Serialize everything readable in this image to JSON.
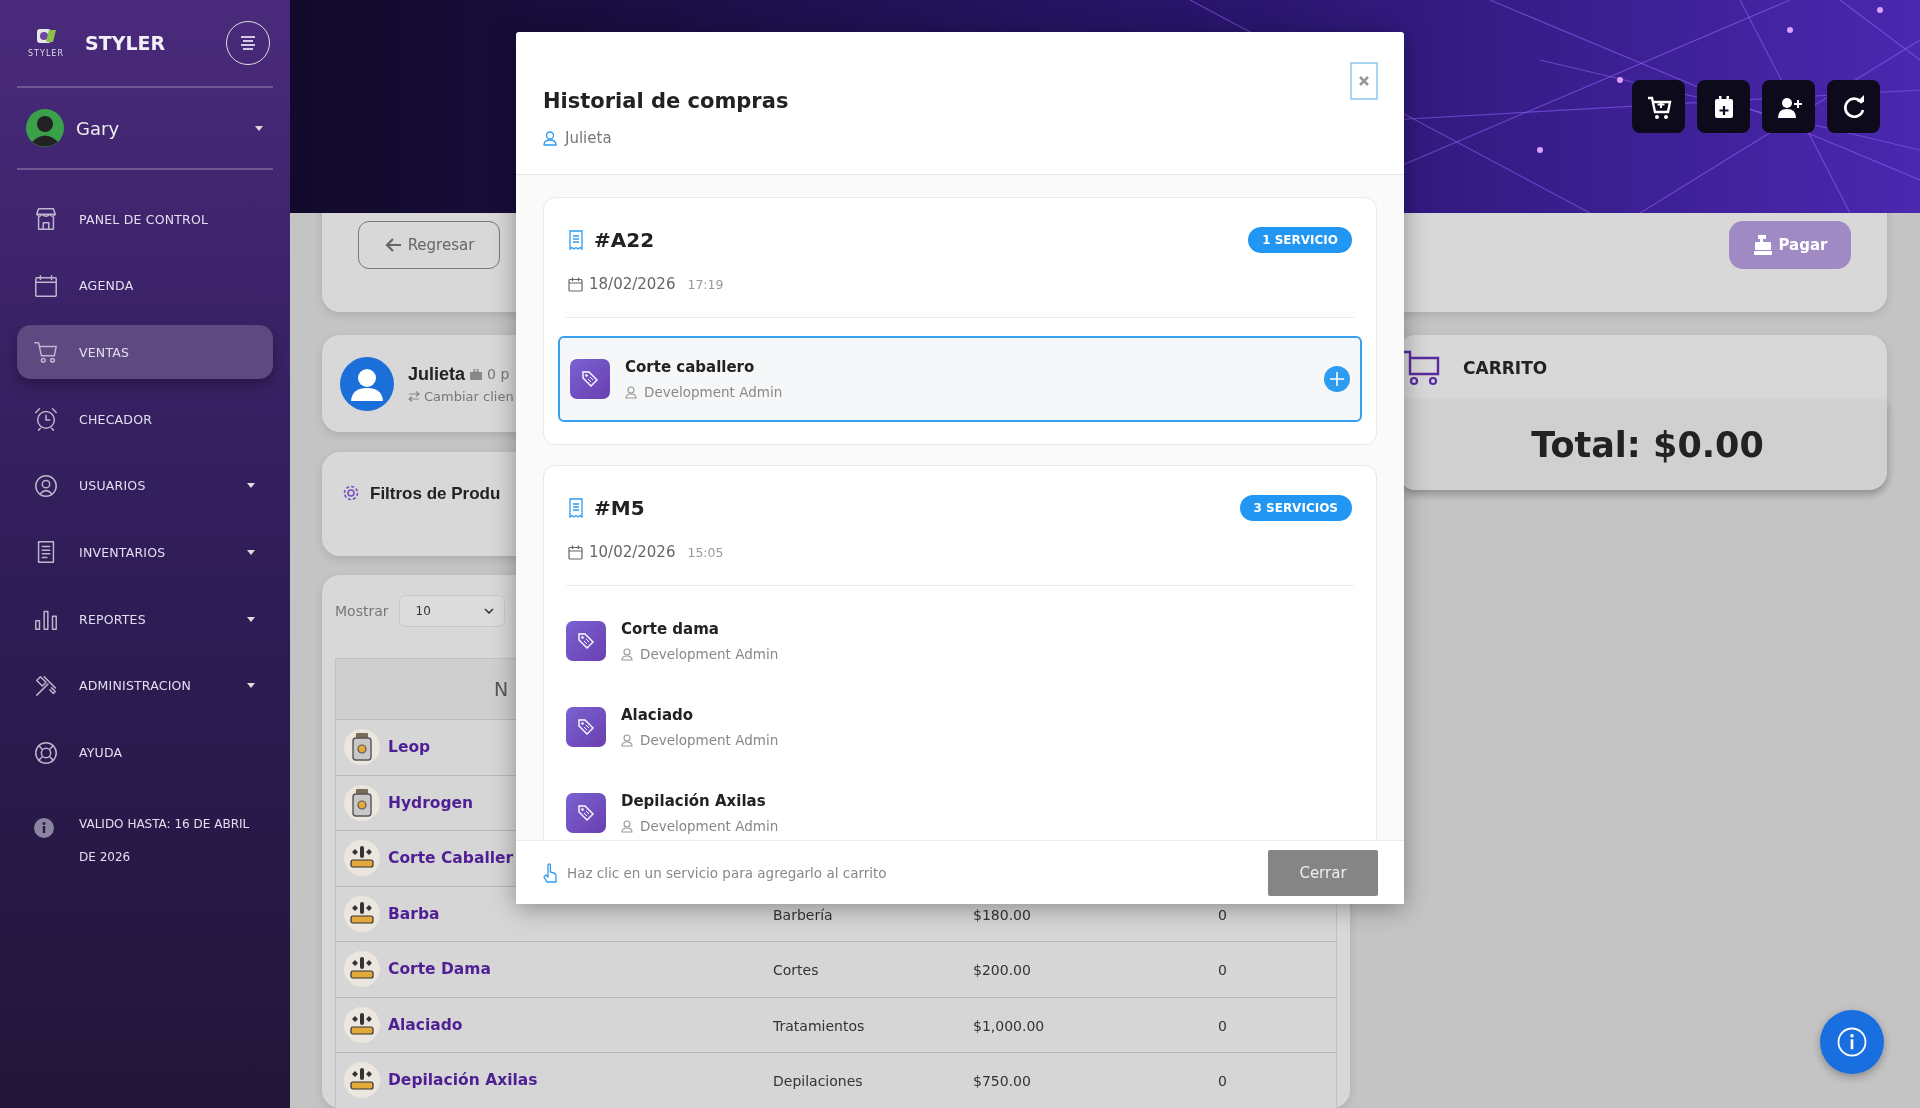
{
  "sidebar": {
    "logo_text": "STYLER",
    "brand": "STYLER",
    "user": {
      "name": "Gary"
    },
    "items": [
      {
        "label": "PANEL DE CONTROL",
        "selected": false,
        "has_submenu": false
      },
      {
        "label": "AGENDA",
        "selected": false,
        "has_submenu": false
      },
      {
        "label": "VENTAS",
        "selected": true,
        "has_submenu": false
      },
      {
        "label": "CHECADOR",
        "selected": false,
        "has_submenu": false
      },
      {
        "label": "USUARIOS",
        "selected": false,
        "has_submenu": true
      },
      {
        "label": "INVENTARIOS",
        "selected": false,
        "has_submenu": true
      },
      {
        "label": "REPORTES",
        "selected": false,
        "has_submenu": true
      },
      {
        "label": "ADMINISTRACION",
        "selected": false,
        "has_submenu": true
      },
      {
        "label": "AYUDA",
        "selected": false,
        "has_submenu": false
      }
    ],
    "validity": "VALIDO HASTA: 16 DE ABRIL DE 2026"
  },
  "toolbar": {
    "back_button": "Regresar",
    "pay_button": {
      "label": "Pagar",
      "disabled": true
    }
  },
  "client": {
    "name": "Julieta",
    "points": "0 p",
    "change_link": "Cambiar clien"
  },
  "filters": {
    "title": "Filtros de Produ"
  },
  "table": {
    "show_label": "Mostrar",
    "page_size": "10",
    "columns": [
      "N"
    ],
    "rows": [
      {
        "kind": "product",
        "name": "Leop"
      },
      {
        "kind": "product",
        "name": "Hydrogen"
      },
      {
        "kind": "service",
        "name": "Corte Caballer"
      },
      {
        "kind": "service",
        "name": "Barba",
        "category": "Barbería",
        "price": "$180.00",
        "stock": "0"
      },
      {
        "kind": "service",
        "name": "Corte Dama",
        "category": "Cortes",
        "price": "$200.00",
        "stock": "0"
      },
      {
        "kind": "service",
        "name": "Alaciado",
        "category": "Tratamientos",
        "price": "$1,000.00",
        "stock": "0"
      },
      {
        "kind": "service",
        "name": "Depilación Axilas",
        "category": "Depilaciones",
        "price": "$750.00",
        "stock": "0"
      }
    ]
  },
  "cart": {
    "title": "CARRITO",
    "total": "Total: $0.00"
  },
  "modal": {
    "title": "Historial de compras",
    "customer": "Julieta",
    "orders": [
      {
        "number": "#A22",
        "badge": "1 SERVICIO",
        "date": "18/02/2026",
        "time": "17:19",
        "items": [
          {
            "name": "Corte caballero",
            "staff": "Development Admin",
            "selected": true
          }
        ]
      },
      {
        "number": "#M5",
        "badge": "3 SERVICIOS",
        "date": "10/02/2026",
        "time": "15:05",
        "items": [
          {
            "name": "Corte dama",
            "staff": "Development Admin",
            "selected": false
          },
          {
            "name": "Alaciado",
            "staff": "Development Admin",
            "selected": false
          },
          {
            "name": "Depilación Axilas",
            "staff": "Development Admin",
            "selected": false
          }
        ]
      }
    ],
    "hint": "Haz clic en un servicio para agregarlo al carrito",
    "close_button": "Cerrar"
  }
}
